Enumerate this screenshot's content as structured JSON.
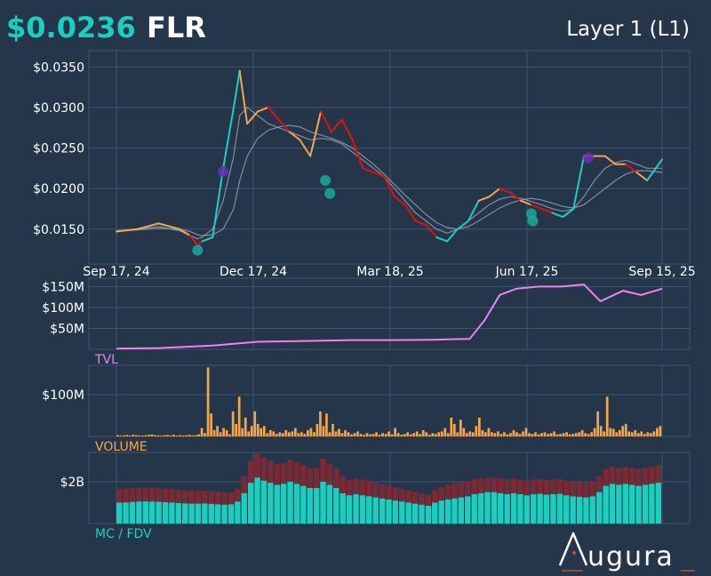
{
  "header": {
    "price": "$0.0236",
    "symbol": "FLR",
    "category": "Layer 1 (L1)"
  },
  "brand": {
    "name": "ugura"
  },
  "colors": {
    "background": "#25364b",
    "grid": "#3e5470",
    "up": "#19cfc0",
    "neutral": "#f5a54a",
    "down": "#e01010",
    "ma": "#9aa4b2",
    "tvl": "#ee82ee",
    "volume": "#f5a54a",
    "mc": "#19cfc0",
    "fdv": "#7a2a35",
    "marker_buy": "#19a99a",
    "marker_sell": "#6a2fb5"
  },
  "chart_data": [
    {
      "type": "line",
      "panel": "price",
      "x_ticks": [
        "Sep 17, 24",
        "Dec 17, 24",
        "Mar 18, 25",
        "Jun 17, 25",
        "Sep 15, 25"
      ],
      "y_ticks": [
        "$0.0150",
        "$0.0200",
        "$0.0250",
        "$0.0300",
        "$0.0350"
      ],
      "ylim": [
        0.0107,
        0.037
      ],
      "x": [
        "2024-09-17",
        "2024-10-01",
        "2024-10-15",
        "2024-10-29",
        "2024-11-05",
        "2024-11-10",
        "2024-11-13",
        "2024-11-20",
        "2024-11-27",
        "2024-12-04",
        "2024-12-08",
        "2024-12-13",
        "2024-12-20",
        "2024-12-27",
        "2025-01-03",
        "2025-01-10",
        "2025-01-17",
        "2025-01-24",
        "2025-01-31",
        "2025-02-07",
        "2025-02-14",
        "2025-02-21",
        "2025-02-28",
        "2025-03-07",
        "2025-03-14",
        "2025-03-21",
        "2025-03-28",
        "2025-04-04",
        "2025-04-11",
        "2025-04-18",
        "2025-04-25",
        "2025-05-02",
        "2025-05-09",
        "2025-05-16",
        "2025-05-23",
        "2025-05-30",
        "2025-06-06",
        "2025-06-13",
        "2025-06-20",
        "2025-06-27",
        "2025-07-04",
        "2025-07-11",
        "2025-07-18",
        "2025-07-25",
        "2025-08-01",
        "2025-08-08",
        "2025-08-15",
        "2025-08-22",
        "2025-08-29",
        "2025-09-05",
        "2025-09-15"
      ],
      "series": [
        {
          "values": [
            0.0147,
            0.015,
            0.0157,
            0.015,
            0.0142,
            0.013,
            0.0135,
            0.014,
            0.0225,
            0.03,
            0.0345,
            0.028,
            0.0295,
            0.03,
            0.0285,
            0.027,
            0.026,
            0.024,
            0.0295,
            0.027,
            0.0285,
            0.026,
            0.0225,
            0.022,
            0.0215,
            0.019,
            0.018,
            0.016,
            0.0155,
            0.014,
            0.0135,
            0.015,
            0.016,
            0.0185,
            0.019,
            0.02,
            0.0195,
            0.0185,
            0.018,
            0.0175,
            0.017,
            0.0165,
            0.0175,
            0.024,
            0.024,
            0.024,
            0.023,
            0.023,
            0.022,
            0.021,
            0.0236
          ],
          "colors": [
            "neutral",
            "neutral",
            "neutral",
            "neutral",
            "neutral",
            "down",
            "down",
            "up",
            "up",
            "up",
            "up",
            "neutral",
            "neutral",
            "neutral",
            "down",
            "down",
            "neutral",
            "neutral",
            "neutral",
            "down",
            "down",
            "down",
            "down",
            "down",
            "down",
            "down",
            "down",
            "down",
            "down",
            "down",
            "up",
            "up",
            "up",
            "up",
            "neutral",
            "neutral",
            "down",
            "down",
            "neutral",
            "down",
            "down",
            "up",
            "up",
            "up",
            "neutral",
            "neutral",
            "neutral",
            "neutral",
            "down",
            "neutral",
            "up"
          ]
        },
        {
          "name": "",
          "values": [
            0.0148,
            0.015,
            0.0153,
            0.0148,
            0.0142,
            0.0138,
            0.014,
            0.015,
            0.0185,
            0.024,
            0.029,
            0.03,
            0.029,
            0.028,
            0.0275,
            0.027,
            0.0265,
            0.026,
            0.0262,
            0.026,
            0.0255,
            0.0245,
            0.0235,
            0.0225,
            0.0215,
            0.02,
            0.0185,
            0.017,
            0.016,
            0.015,
            0.0145,
            0.015,
            0.016,
            0.017,
            0.018,
            0.0187,
            0.019,
            0.0188,
            0.0184,
            0.018,
            0.0175,
            0.0172,
            0.0175,
            0.019,
            0.021,
            0.0225,
            0.0232,
            0.0235,
            0.023,
            0.0225,
            0.0225
          ]
        },
        {
          "name": "",
          "values": [
            0.0148,
            0.0149,
            0.0151,
            0.015,
            0.0147,
            0.0143,
            0.0142,
            0.0143,
            0.015,
            0.0175,
            0.021,
            0.024,
            0.0262,
            0.0272,
            0.0276,
            0.0278,
            0.0276,
            0.027,
            0.0266,
            0.0262,
            0.0257,
            0.025,
            0.024,
            0.023,
            0.0218,
            0.0205,
            0.0192,
            0.018,
            0.0168,
            0.0158,
            0.0152,
            0.015,
            0.0153,
            0.016,
            0.0168,
            0.0176,
            0.0182,
            0.0186,
            0.0188,
            0.0186,
            0.0182,
            0.0178,
            0.0176,
            0.018,
            0.019,
            0.02,
            0.021,
            0.0218,
            0.0222,
            0.0222,
            0.022
          ]
        }
      ],
      "markers": [
        {
          "x": "2024-11-10",
          "y": 0.0124,
          "kind": "buy"
        },
        {
          "x": "2024-11-27",
          "y": 0.0221,
          "kind": "sell"
        },
        {
          "x": "2025-02-03",
          "y": 0.021,
          "kind": "buy"
        },
        {
          "x": "2025-02-06",
          "y": 0.0194,
          "kind": "buy"
        },
        {
          "x": "2025-06-20",
          "y": 0.0169,
          "kind": "buy"
        },
        {
          "x": "2025-06-21",
          "y": 0.016,
          "kind": "buy"
        },
        {
          "x": "2025-07-28",
          "y": 0.0238,
          "kind": "sell"
        }
      ]
    },
    {
      "type": "line",
      "panel": "tvl",
      "label": "TVL",
      "y_ticks": [
        "$50M",
        "$100M",
        "$150M"
      ],
      "ylim": [
        0,
        170000000
      ],
      "x": [
        "2024-09-17",
        "2024-10-15",
        "2024-11-20",
        "2024-12-20",
        "2025-01-20",
        "2025-02-20",
        "2025-03-20",
        "2025-04-15",
        "2025-05-10",
        "2025-05-20",
        "2025-05-30",
        "2025-06-10",
        "2025-06-25",
        "2025-07-10",
        "2025-07-25",
        "2025-08-05",
        "2025-08-20",
        "2025-09-01",
        "2025-09-15"
      ],
      "values": [
        2000000,
        3000000,
        9000000,
        18000000,
        20000000,
        22000000,
        22000000,
        23000000,
        25000000,
        70000000,
        130000000,
        145000000,
        150000000,
        150000000,
        155000000,
        115000000,
        140000000,
        130000000,
        145000000
      ]
    },
    {
      "type": "bar",
      "panel": "volume",
      "label": "VOLUME",
      "y_ticks": [
        "$100M"
      ],
      "ylim": [
        0,
        170000000
      ],
      "values": [
        3000000,
        2000000,
        2500000,
        3500000,
        2000000,
        4000000,
        3000000,
        2500000,
        2000000,
        3000000,
        4000000,
        5000000,
        3000000,
        2500000,
        2000000,
        3000000,
        3500000,
        2500000,
        4000000,
        2000000,
        3000000,
        2500000,
        3000000,
        4000000,
        2500000,
        3000000,
        5000000,
        20000000,
        8000000,
        165000000,
        55000000,
        15000000,
        25000000,
        10000000,
        20000000,
        15000000,
        5000000,
        60000000,
        30000000,
        95000000,
        20000000,
        45000000,
        12000000,
        25000000,
        60000000,
        30000000,
        20000000,
        25000000,
        8000000,
        15000000,
        12000000,
        6000000,
        10000000,
        8000000,
        15000000,
        10000000,
        12000000,
        20000000,
        8000000,
        10000000,
        6000000,
        15000000,
        20000000,
        10000000,
        30000000,
        60000000,
        25000000,
        55000000,
        10000000,
        30000000,
        12000000,
        18000000,
        8000000,
        15000000,
        10000000,
        5000000,
        8000000,
        12000000,
        6000000,
        4000000,
        8000000,
        5000000,
        6000000,
        10000000,
        4000000,
        8000000,
        6000000,
        12000000,
        5000000,
        20000000,
        8000000,
        4000000,
        6000000,
        10000000,
        5000000,
        8000000,
        12000000,
        6000000,
        15000000,
        10000000,
        4000000,
        8000000,
        6000000,
        10000000,
        12000000,
        20000000,
        8000000,
        45000000,
        30000000,
        10000000,
        40000000,
        20000000,
        8000000,
        12000000,
        10000000,
        25000000,
        45000000,
        15000000,
        10000000,
        20000000,
        10000000,
        8000000,
        12000000,
        6000000,
        10000000,
        5000000,
        8000000,
        15000000,
        10000000,
        6000000,
        12000000,
        20000000,
        8000000,
        6000000,
        10000000,
        5000000,
        8000000,
        10000000,
        6000000,
        8000000,
        12000000,
        5000000,
        6000000,
        8000000,
        10000000,
        5000000,
        6000000,
        8000000,
        10000000,
        15000000,
        8000000,
        6000000,
        10000000,
        20000000,
        60000000,
        25000000,
        12000000,
        95000000,
        20000000,
        18000000,
        10000000,
        15000000,
        25000000,
        30000000,
        12000000,
        10000000,
        15000000,
        8000000,
        12000000,
        6000000,
        10000000,
        8000000,
        12000000,
        20000000,
        25000000
      ]
    },
    {
      "type": "bar",
      "panel": "mc_fdv",
      "label": "MC / FDV",
      "y_ticks": [
        "$2B"
      ],
      "ylim": [
        0,
        3400000000
      ],
      "series": [
        {
          "name": "MC",
          "values": [
            1000000000,
            1010000000,
            1030000000,
            1050000000,
            1060000000,
            1050000000,
            1040000000,
            1020000000,
            1000000000,
            980000000,
            960000000,
            950000000,
            950000000,
            960000000,
            940000000,
            920000000,
            900000000,
            920000000,
            1050000000,
            1450000000,
            1950000000,
            2200000000,
            2050000000,
            1950000000,
            1850000000,
            1900000000,
            2000000000,
            1900000000,
            1800000000,
            1700000000,
            1700000000,
            2000000000,
            1850000000,
            1700000000,
            1450000000,
            1350000000,
            1400000000,
            1350000000,
            1300000000,
            1250000000,
            1200000000,
            1150000000,
            1100000000,
            1050000000,
            1000000000,
            950000000,
            900000000,
            850000000,
            1000000000,
            1100000000,
            1150000000,
            1200000000,
            1250000000,
            1300000000,
            1400000000,
            1450000000,
            1500000000,
            1500000000,
            1450000000,
            1400000000,
            1450000000,
            1400000000,
            1350000000,
            1400000000,
            1420000000,
            1380000000,
            1400000000,
            1420000000,
            1350000000,
            1300000000,
            1280000000,
            1250000000,
            1300000000,
            1500000000,
            1800000000,
            1900000000,
            1850000000,
            1900000000,
            1850000000,
            1800000000,
            1850000000,
            1900000000,
            1950000000
          ]
        },
        {
          "name": "FDV",
          "values": [
            1650000000,
            1660000000,
            1680000000,
            1700000000,
            1710000000,
            1700000000,
            1690000000,
            1670000000,
            1640000000,
            1610000000,
            1580000000,
            1560000000,
            1560000000,
            1570000000,
            1550000000,
            1520000000,
            1480000000,
            1500000000,
            1650000000,
            2250000000,
            3000000000,
            3350000000,
            3150000000,
            3000000000,
            2850000000,
            2900000000,
            3050000000,
            2950000000,
            2800000000,
            2650000000,
            2650000000,
            3100000000,
            2850000000,
            2650000000,
            2250000000,
            2100000000,
            2150000000,
            2100000000,
            2000000000,
            1950000000,
            1880000000,
            1800000000,
            1720000000,
            1650000000,
            1580000000,
            1500000000,
            1430000000,
            1380000000,
            1600000000,
            1750000000,
            1830000000,
            1900000000,
            1950000000,
            2000000000,
            2100000000,
            2150000000,
            2200000000,
            2200000000,
            2150000000,
            2100000000,
            2150000000,
            2100000000,
            2050000000,
            2100000000,
            2120000000,
            2080000000,
            2100000000,
            2120000000,
            2050000000,
            2000000000,
            1980000000,
            1950000000,
            2000000000,
            2250000000,
            2600000000,
            2700000000,
            2650000000,
            2700000000,
            2650000000,
            2600000000,
            2650000000,
            2700000000,
            2800000000
          ]
        }
      ]
    }
  ]
}
